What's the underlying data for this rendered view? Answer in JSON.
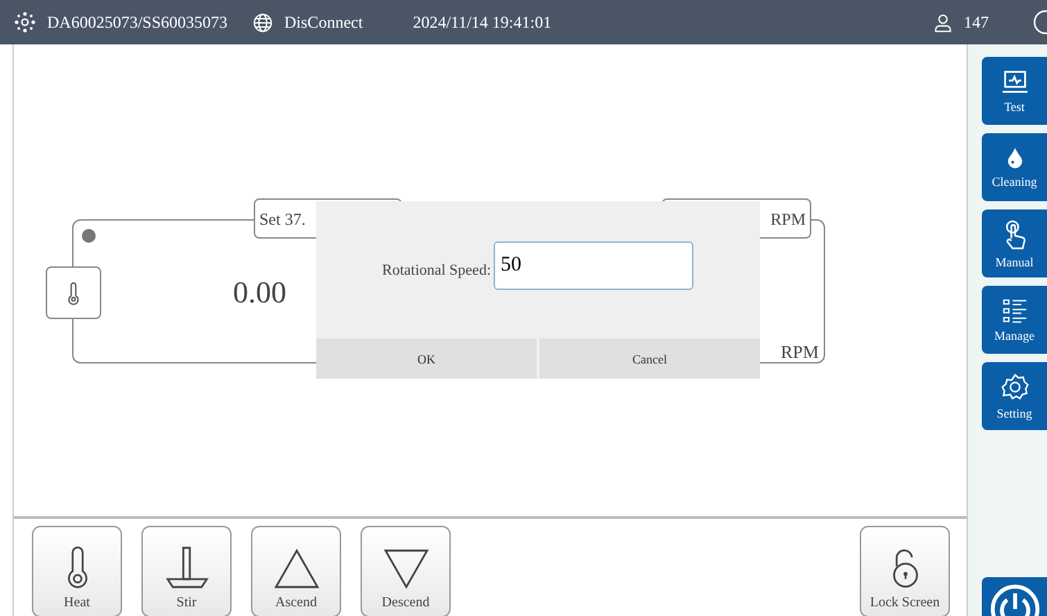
{
  "top_bar": {
    "device": "DA60025073/SS60035073",
    "connection": "DisConnect",
    "datetime": "2024/11/14 19:41:01",
    "user_count": "147"
  },
  "panel": {
    "set_label": "Set 37.",
    "value": "0.00",
    "unit_top": "RPM",
    "unit_bottom": "RPM"
  },
  "dialog": {
    "label": "Rotational Speed:",
    "value": "50",
    "buttons": [
      "OK",
      "Cancel"
    ]
  },
  "toolbar": [
    {
      "kind": "heat",
      "label": "Heat"
    },
    {
      "kind": "stir",
      "label": "Stir"
    },
    {
      "kind": "ascend",
      "label": "Ascend"
    },
    {
      "kind": "descend",
      "label": "Descend"
    }
  ],
  "lock_button": {
    "label": "Lock Screen"
  },
  "sidebar": [
    {
      "kind": "test",
      "label": "Test"
    },
    {
      "kind": "cleaning",
      "label": "Cleaning"
    },
    {
      "kind": "manual",
      "label": "Manual"
    },
    {
      "kind": "manage",
      "label": "Manage"
    },
    {
      "kind": "setting",
      "label": "Setting"
    }
  ]
}
